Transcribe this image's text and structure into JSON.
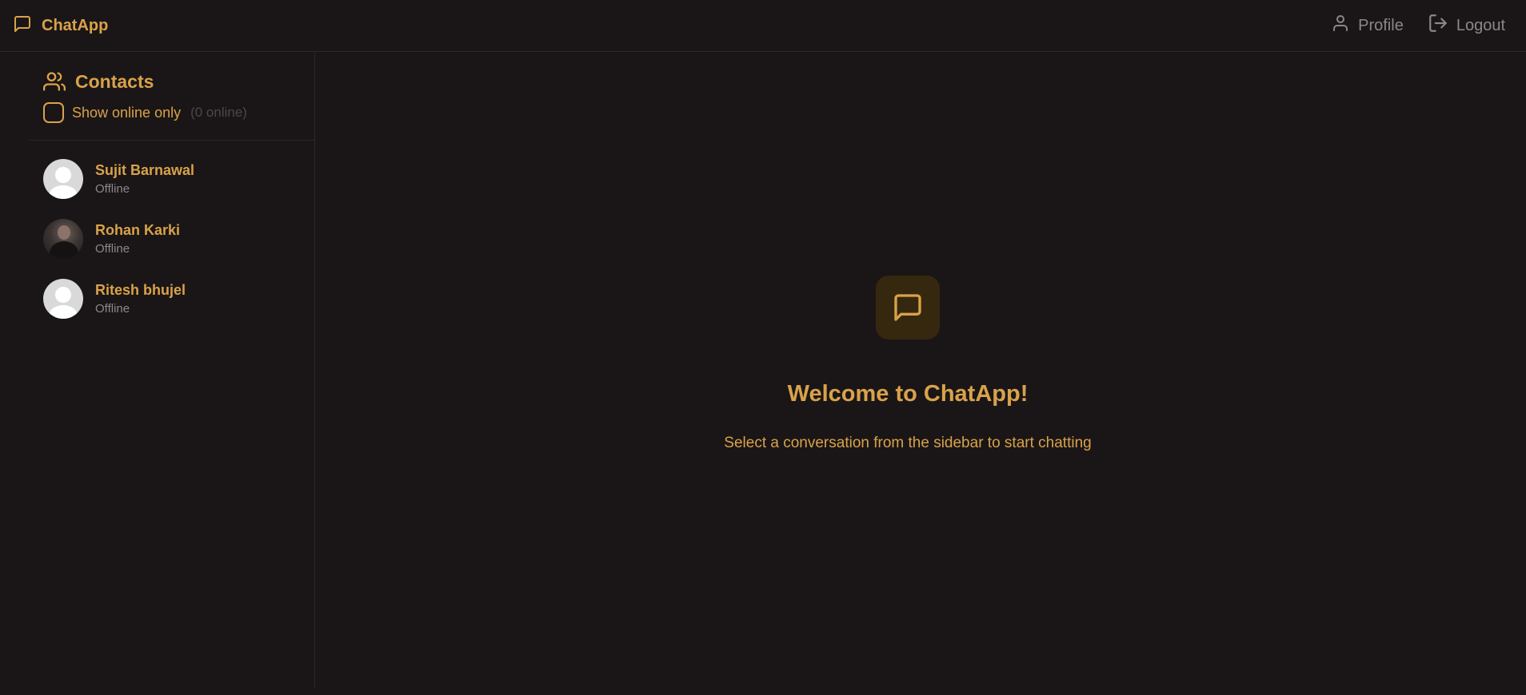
{
  "header": {
    "brand": "ChatApp",
    "nav": {
      "profile_label": "Profile",
      "logout_label": "Logout"
    }
  },
  "sidebar": {
    "title": "Contacts",
    "online_toggle_label": "Show online only",
    "online_count": "(0 online)",
    "contacts": [
      {
        "name": "Sujit Barnawal",
        "status": "Offline"
      },
      {
        "name": "Rohan Karki",
        "status": "Offline"
      },
      {
        "name": "Ritesh bhujel",
        "status": "Offline"
      }
    ]
  },
  "main": {
    "welcome_title": "Welcome to ChatApp!",
    "welcome_subtitle": "Select a conversation from the sidebar to start chatting"
  },
  "colors": {
    "background": "#1a1617",
    "accent": "#d9a24a",
    "muted": "#8c8688"
  }
}
